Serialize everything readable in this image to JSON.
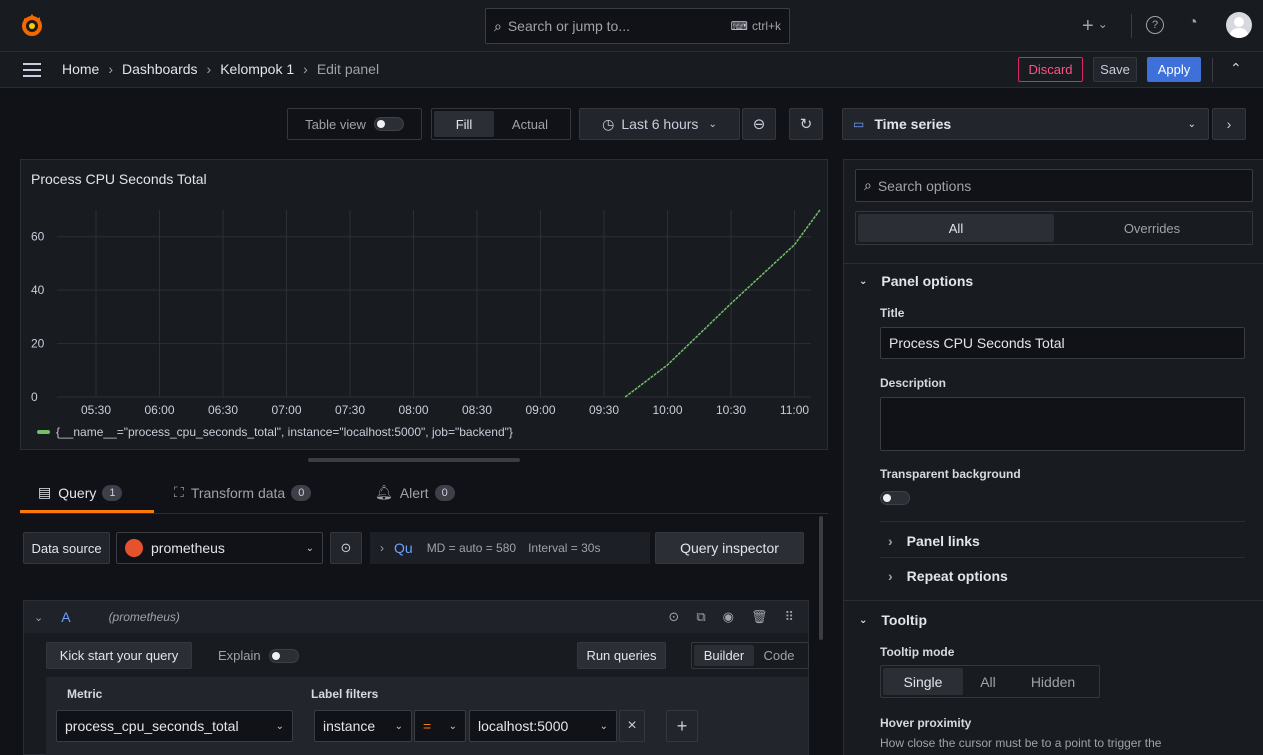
{
  "topbar": {
    "search_placeholder": "Search or jump to...",
    "shortcut": "ctrl+k",
    "plus": "+",
    "chevron": "⌄"
  },
  "breadcrumb": [
    "Home",
    "Dashboards",
    "Kelompok 1",
    "Edit panel"
  ],
  "nav_actions": {
    "discard": "Discard",
    "save": "Save",
    "apply": "Apply"
  },
  "toolbar": {
    "table_view": "Table view",
    "fill": "Fill",
    "actual": "Actual",
    "time_range": "Last 6 hours"
  },
  "panel": {
    "title": "Process CPU Seconds Total",
    "legend": "{__name__=\"process_cpu_seconds_total\", instance=\"localhost:5000\", job=\"backend\"}"
  },
  "chart_data": {
    "type": "line",
    "x_ticks": [
      "05:30",
      "06:00",
      "06:30",
      "07:00",
      "07:30",
      "08:00",
      "08:30",
      "09:00",
      "09:30",
      "10:00",
      "10:30",
      "11:00"
    ],
    "y_ticks": [
      0,
      20,
      40,
      60
    ],
    "ylim": [
      0,
      70
    ],
    "series": [
      {
        "name": "{__name__=\"process_cpu_seconds_total\", instance=\"localhost:5000\", job=\"backend\"}",
        "color": "#73bf69",
        "x": [
          "09:40",
          "10:00",
          "10:30",
          "11:00",
          "11:12"
        ],
        "y": [
          0,
          12,
          35,
          57,
          70
        ]
      }
    ],
    "grid": true
  },
  "query_tabs": [
    {
      "label": "Query",
      "count": "1"
    },
    {
      "label": "Transform data",
      "count": "0"
    },
    {
      "label": "Alert",
      "count": "0"
    }
  ],
  "datasource": {
    "label": "Data source",
    "value": "prometheus",
    "qu": "Qu",
    "md": "MD = auto = 580",
    "interval": "Interval = 30s",
    "inspector": "Query inspector"
  },
  "query_row": {
    "letter": "A",
    "source": "(prometheus)",
    "kick": "Kick start your query",
    "explain": "Explain",
    "run": "Run queries",
    "builder": "Builder",
    "code": "Code",
    "metric_label": "Metric",
    "metric_value": "process_cpu_seconds_total",
    "label_filters": "Label filters",
    "filter_key": "instance",
    "filter_op": "=",
    "filter_value": "localhost:5000",
    "remove": "×",
    "add": "+"
  },
  "options": {
    "viz": "Time series",
    "search_placeholder": "Search options",
    "tab_all": "All",
    "tab_overrides": "Overrides",
    "panel_options": "Panel options",
    "title_label": "Title",
    "title_value": "Process CPU Seconds Total",
    "description_label": "Description",
    "transparent_label": "Transparent background",
    "panel_links": "Panel links",
    "repeat_options": "Repeat options",
    "tooltip": "Tooltip",
    "tooltip_mode": "Tooltip mode",
    "mode_single": "Single",
    "mode_all": "All",
    "mode_hidden": "Hidden",
    "hover_proximity": "Hover proximity",
    "hover_desc": "How close the cursor must be to a point to trigger the"
  },
  "colors": {
    "accent": "#3d71d9",
    "discard": "#e0226e",
    "series": "#73bf69",
    "orange": "#ff780a"
  }
}
